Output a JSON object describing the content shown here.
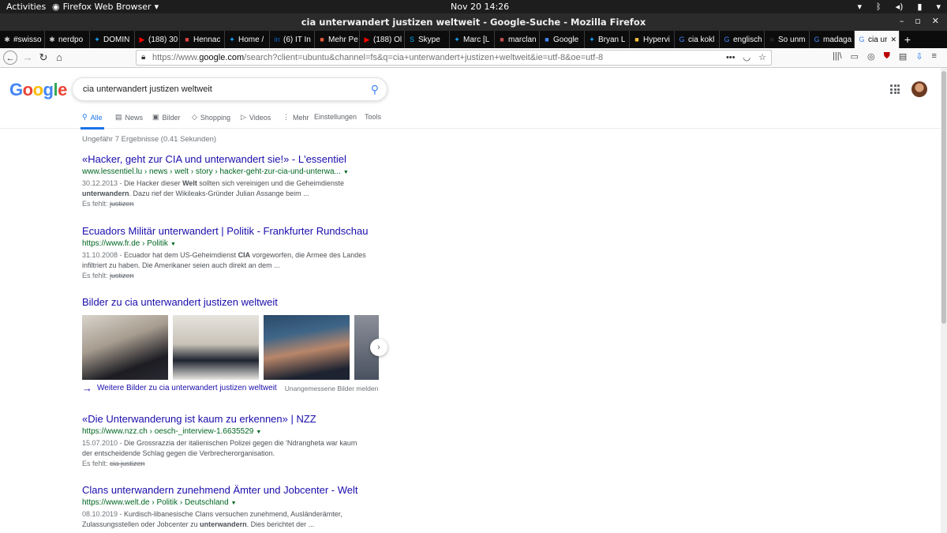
{
  "system_bar": {
    "activities": "Activities",
    "app_name": "Firefox Web Browser",
    "clock": "Nov 20  14:26"
  },
  "window": {
    "title": "cia unterwandert justizen weltweit - Google-Suche - Mozilla Firefox"
  },
  "tabs": [
    {
      "label": "#swisso",
      "icon": "slack-icon",
      "color": "#cccccc"
    },
    {
      "label": "nerdpo",
      "icon": "slack-icon",
      "color": "#cccccc"
    },
    {
      "label": "DOMIN",
      "icon": "twitter-icon",
      "color": "#1da1f2"
    },
    {
      "label": "(188) 30",
      "icon": "youtube-icon",
      "color": "#ff0000"
    },
    {
      "label": "Hennac",
      "icon": "page-icon",
      "color": "#dd4444"
    },
    {
      "label": "Home /",
      "icon": "twitter-icon",
      "color": "#1da1f2"
    },
    {
      "label": "(6) IT In",
      "icon": "linkedin-icon",
      "color": "#0a66c2"
    },
    {
      "label": "Mehr Pe",
      "icon": "page-icon",
      "color": "#e55b3c"
    },
    {
      "label": "(188) Ol",
      "icon": "youtube-icon",
      "color": "#ff0000"
    },
    {
      "label": "Skype",
      "icon": "skype-icon",
      "color": "#00aff0"
    },
    {
      "label": "Marc [L",
      "icon": "twitter-icon",
      "color": "#1da1f2"
    },
    {
      "label": "marclan",
      "icon": "page-icon",
      "color": "#c0504d"
    },
    {
      "label": "Google",
      "icon": "page-icon",
      "color": "#4285f4"
    },
    {
      "label": "Bryan L",
      "icon": "twitter-icon",
      "color": "#1da1f2"
    },
    {
      "label": "Hypervi",
      "icon": "page-icon",
      "color": "#f6c141"
    },
    {
      "label": "cia kokl",
      "icon": "google-icon",
      "color": "#4285f4"
    },
    {
      "label": "englisch",
      "icon": "google-icon",
      "color": "#4285f4"
    },
    {
      "label": "So unm",
      "icon": "page-icon",
      "color": "#222222"
    },
    {
      "label": "madaga",
      "icon": "google-icon",
      "color": "#4285f4"
    },
    {
      "label": "cia ur",
      "icon": "google-icon",
      "color": "#4285f4",
      "active": true
    }
  ],
  "urlbar": {
    "prefix": "https://www.",
    "host": "google.com",
    "path": "/search?client=ubuntu&channel=fs&q=cia+unterwandert+justizen+weltweit&ie=utf-8&oe=utf-8"
  },
  "google": {
    "logo_letters": [
      "G",
      "o",
      "o",
      "g",
      "l",
      "e"
    ],
    "query": "cia unterwandert justizen weltweit",
    "nav_tabs": [
      {
        "label": "Alle",
        "icon": "search-icon",
        "active": true
      },
      {
        "label": "News",
        "icon": "news-icon"
      },
      {
        "label": "Bilder",
        "icon": "image-icon"
      },
      {
        "label": "Shopping",
        "icon": "tag-icon"
      },
      {
        "label": "Videos",
        "icon": "play-icon"
      },
      {
        "label": "Mehr",
        "icon": "more-vert-icon"
      },
      {
        "label": "Einstellungen",
        "icon": ""
      },
      {
        "label": "Tools",
        "icon": ""
      }
    ],
    "stats": "Ungefähr 7 Ergebnisse (0.41 Sekunden)"
  },
  "results": [
    {
      "title": "«Hacker, geht zur CIA und unterwandert sie!» - L'essentiel",
      "url": "www.lessentiel.lu › news › welt › story › hacker-geht-zur-cia-und-unterwa...",
      "date": "30.12.2013",
      "snippet_html": "Die Hacker dieser <b>Welt</b> sollten sich vereinigen und die Geheimdienste <b>unterwandern</b>. Dazu rief der Wikileaks-Gründer Julian Assange beim ...",
      "missing_label": "Es fehlt:",
      "missing_terms": "justizen"
    },
    {
      "title": "Ecuadors Militär unterwandert | Politik - Frankfurter Rundschau",
      "url": "https://www.fr.de › Politik",
      "date": "31.10.2008",
      "snippet_html": "Ecuador hat dem US-Geheimdienst <b>CIA</b> vorgeworfen, die Armee des Landes infiltriert zu haben. Die Amerikaner seien auch direkt an dem ...",
      "missing_label": "Es fehlt:",
      "missing_terms": "justizen"
    },
    {
      "title": "«Die Unterwanderung ist kaum zu erkennen» | NZZ",
      "url": "https://www.nzz.ch › oesch-_interview-1.6635529",
      "date": "15.07.2010",
      "snippet_html": "Die Grossrazzia der italienischen Polizei gegen die 'Ndrangheta war kaum der entscheidende Schlag gegen die Verbrecherorganisation.",
      "missing_label": "Es fehlt:",
      "missing_terms": "cia justizen"
    },
    {
      "title": "Clans unterwandern zunehmend Ämter und Jobcenter - Welt",
      "url": "https://www.welt.de › Politik › Deutschland",
      "date": "08.10.2019",
      "snippet_html": "Kurdisch-libanesische Clans versuchen zunehmend, Ausländerämter, Zulassungsstellen oder Jobcenter zu <b>unterwandern</b>. Dies berichtet der ...",
      "missing_label": "",
      "missing_terms": ""
    }
  ],
  "images": {
    "title": "Bilder zu cia unterwandert justizen weltweit",
    "more_link": "Weitere Bilder zu cia unterwandert justizen weltweit",
    "report": "Unangemessene Bilder melden",
    "next_icon": "chevron-right-icon"
  }
}
